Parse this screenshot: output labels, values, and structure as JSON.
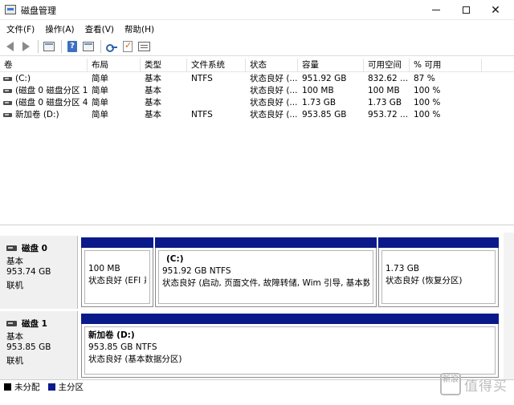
{
  "window": {
    "title": "磁盘管理",
    "controls": {
      "minimize": "minimize",
      "maximize": "maximize",
      "close": "✕"
    }
  },
  "menu": [
    "文件(F)",
    "操作(A)",
    "查看(V)",
    "帮助(H)"
  ],
  "toolbar": [
    "back-icon",
    "forward-icon",
    "show-pane-icon",
    "help-icon",
    "panel-icon",
    "connect-icon",
    "check-icon",
    "properties-icon"
  ],
  "table": {
    "columns": [
      "卷",
      "布局",
      "类型",
      "文件系统",
      "状态",
      "容量",
      "可用空间",
      "% 可用"
    ],
    "rows": [
      [
        "(C:)",
        "简单",
        "基本",
        "NTFS",
        "状态良好 (...",
        "951.92 GB",
        "832.62 ...",
        "87 %"
      ],
      [
        "(磁盘 0 磁盘分区 1)",
        "简单",
        "基本",
        "",
        "状态良好 (...",
        "100 MB",
        "100 MB",
        "100 %"
      ],
      [
        "(磁盘 0 磁盘分区 4)",
        "简单",
        "基本",
        "",
        "状态良好 (...",
        "1.73 GB",
        "1.73 GB",
        "100 %"
      ],
      [
        "新加卷 (D:)",
        "简单",
        "基本",
        "NTFS",
        "状态良好 (...",
        "953.85 GB",
        "953.72 ...",
        "100 %"
      ]
    ]
  },
  "disks": [
    {
      "name": "磁盘 0",
      "type": "基本",
      "size": "953.74 GB",
      "status": "联机",
      "partitions": [
        {
          "title": "",
          "size": "100 MB",
          "status": "状态良好 (EFI 系统分区)"
        },
        {
          "title": "(C:)",
          "size": "951.92 GB NTFS",
          "status": "状态良好 (启动, 页面文件, 故障转储, Wim 引导, 基本数据分区)"
        },
        {
          "title": "",
          "size": "1.73 GB",
          "status": "状态良好 (恢复分区)"
        }
      ]
    },
    {
      "name": "磁盘 1",
      "type": "基本",
      "size": "953.85 GB",
      "status": "联机",
      "partitions": [
        {
          "title": "新加卷 (D:)",
          "size": "953.85 GB NTFS",
          "status": "状态良好 (基本数据分区)"
        }
      ]
    }
  ],
  "legend": [
    {
      "label": "未分配",
      "color": "#000000"
    },
    {
      "label": "主分区",
      "color": "#0b1a8a"
    }
  ],
  "watermark": {
    "badge": "新浪",
    "text": "值得买"
  }
}
